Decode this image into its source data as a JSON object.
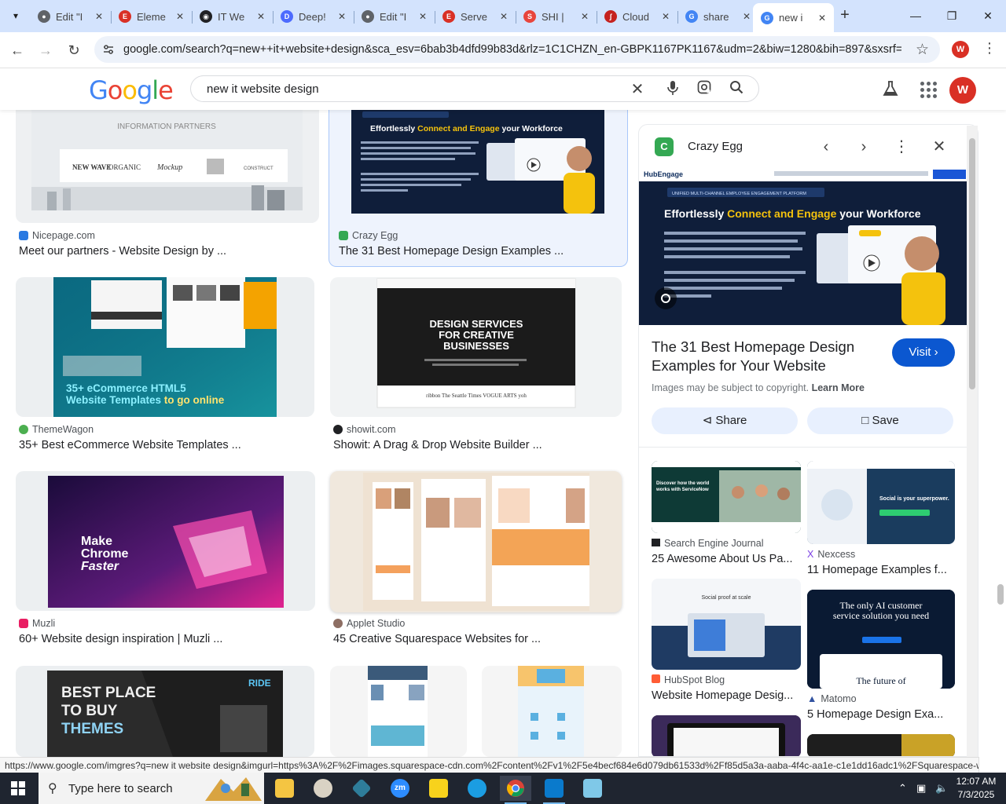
{
  "browser": {
    "tabs": [
      {
        "title": "Edit \"I",
        "color": "#5f6368",
        "icon": "globe-icon"
      },
      {
        "title": "Eleme",
        "color": "#d93025",
        "icon": "elementor-icon"
      },
      {
        "title": "IT We",
        "color": "#202124",
        "icon": "site-icon"
      },
      {
        "title": "Deep!",
        "color": "#4d6bfe",
        "icon": "deepseek-icon"
      },
      {
        "title": "Edit \"I",
        "color": "#5f6368",
        "icon": "globe-icon"
      },
      {
        "title": "Serve",
        "color": "#d93025",
        "icon": "elementor-icon"
      },
      {
        "title": "SHI |",
        "color": "#e8453c",
        "icon": "shi-icon"
      },
      {
        "title": "Cloud",
        "color": "#c5221f",
        "icon": "cloud-icon"
      },
      {
        "title": "share",
        "color": "#4285f4",
        "icon": "google-icon"
      },
      {
        "title": "new i",
        "color": "#4285f4",
        "icon": "google-icon",
        "active": true
      }
    ],
    "url": "google.com/search?q=new++it+website+design&sca_esv=6bab3b4dfd99b83d&rlz=1C1CHZN_en-GBPK1167PK1167&udm=2&biw=1280&bih=897&sxsrf=AE...",
    "profile_initial": "W"
  },
  "google": {
    "logo": [
      "G",
      "o",
      "o",
      "g",
      "l",
      "e"
    ],
    "logo_colors": [
      "#4285f4",
      "#ea4335",
      "#fbbc05",
      "#4285f4",
      "#34a853",
      "#ea4335"
    ],
    "query": "new it website design",
    "profile_initial": "W"
  },
  "results": [
    {
      "source": "Nicepage.com",
      "title": "Meet our partners - Website Design by ...",
      "src_color": "#2a7ae2",
      "thumb_text": "INFORMATION PARTNERS"
    },
    {
      "source": "Crazy Egg",
      "title": "The 31 Best Homepage Design Examples ...",
      "src_color": "#34a853",
      "thumb_text": "Effortlessly Connect and Engage your Workforce"
    },
    {
      "source": "ThemeWagon",
      "title": "35+ Best eCommerce Website Templates ...",
      "src_color": "#4caf50",
      "thumb_text": "35+ eCommerce HTML5 Website Templates to go online"
    },
    {
      "source": "showit.com",
      "title": "Showit: A Drag & Drop Website Builder ...",
      "src_color": "#202124",
      "thumb_text": "DESIGN SERVICES FOR CREATIVE BUSINESSES"
    },
    {
      "source": "Muzli",
      "title": "60+ Website design inspiration | Muzli ...",
      "src_color": "#e91e63",
      "thumb_text": "Make Chrome Faster"
    },
    {
      "source": "Applet Studio",
      "title": "45 Creative Squarespace Websites for ...",
      "src_color": "#8d6e63",
      "thumb_text": ""
    },
    {
      "source": "",
      "title": "",
      "src_color": "#202124",
      "thumb_text": "BEST PLACE TO BUY THEMES"
    }
  ],
  "panel": {
    "site": "Crazy Egg",
    "hero_brand": "HubEngage",
    "hero_badge": "UNIFIED MULTI-CHANNEL EMPLOYEE ENGAGEMENT PLATFORM",
    "hero_headline_a": "Effortlessly ",
    "hero_headline_b": "Connect and Engage",
    "hero_headline_c": " your Workforce",
    "title": "The 31 Best Homepage Design Examples for Your Website",
    "visit_label": "Visit",
    "copyright": "Images may be subject to copyright.",
    "learn_more": "Learn More",
    "share_label": "Share",
    "save_label": "Save",
    "related": [
      {
        "source": "Search Engine Journal",
        "title": "25 Awesome About Us Pa...",
        "thumb_text": "Discover how the world works with ServiceNow"
      },
      {
        "source": "Nexcess",
        "title": "11 Homepage Examples f...",
        "thumb_text": "Social is your superpower."
      },
      {
        "source": "HubSpot Blog",
        "title": "Website Homepage Desig...",
        "thumb_text": "Social proof at scale"
      },
      {
        "source": "Matomo",
        "title": "5 Homepage Design Exa...",
        "thumb_text": "The only AI customer service solution you need",
        "thumb_text2": "The future of"
      }
    ]
  },
  "status_url": "https://www.google.com/imgres?q=new  it website design&imgurl=https%3A%2F%2Fimages.squarespace-cdn.com%2Fcontent%2Fv1%2F5e4becf684e6d079db61533d%2Ff85d5a3a-aaba-4f4c-aa1e-c1e1dd16adc1%2FSquarespace-we...",
  "taskbar": {
    "search_placeholder": "Type here to search",
    "time": "12:07 AM",
    "date": "7/3/2025"
  }
}
